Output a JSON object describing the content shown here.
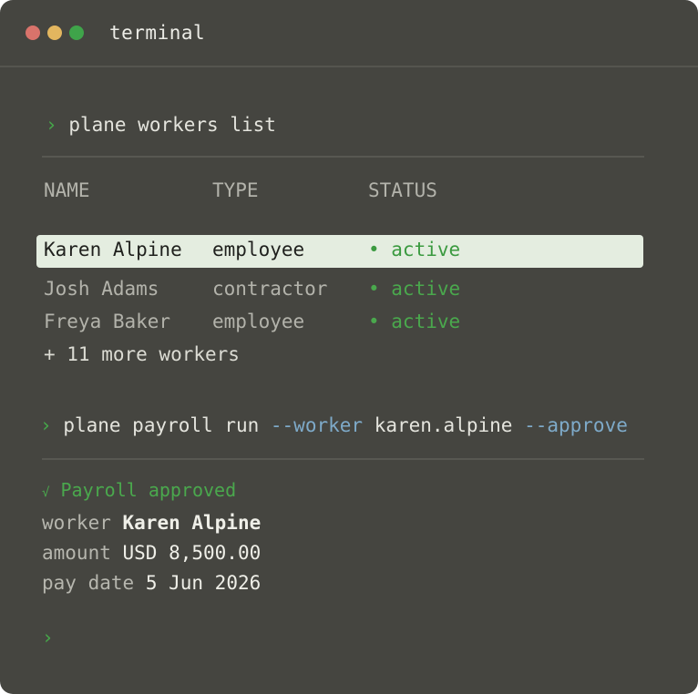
{
  "window": {
    "title": "terminal"
  },
  "cmd1": {
    "prompt": "›",
    "text": "plane workers list"
  },
  "table": {
    "headers": [
      "NAME",
      "TYPE",
      "STATUS"
    ],
    "rows": [
      {
        "name": "Karen Alpine",
        "type": "employee",
        "status": "• active"
      },
      {
        "name": "Josh Adams",
        "type": "contractor",
        "status": "• active"
      },
      {
        "name": "Freya Baker",
        "type": "employee",
        "status": "• active"
      }
    ],
    "more": "+ 11 more workers"
  },
  "cmd2": {
    "prompt": "›",
    "parts": [
      "plane payroll run ",
      "--worker",
      " karen.alpine ",
      "--approve"
    ]
  },
  "result": {
    "check": "√",
    "message": "Payroll approved",
    "fields": [
      {
        "key": "worker",
        "value": "Karen Alpine"
      },
      {
        "key": "amount",
        "value": "USD 8,500.00"
      },
      {
        "key": "pay date",
        "value": "5 Jun 2026"
      }
    ]
  },
  "cmd3": {
    "prompt": "›"
  },
  "colors": {
    "prompt": "#46a84a",
    "flag": "#7eaac9",
    "selection": "#e4ede0",
    "background": "#454540"
  }
}
